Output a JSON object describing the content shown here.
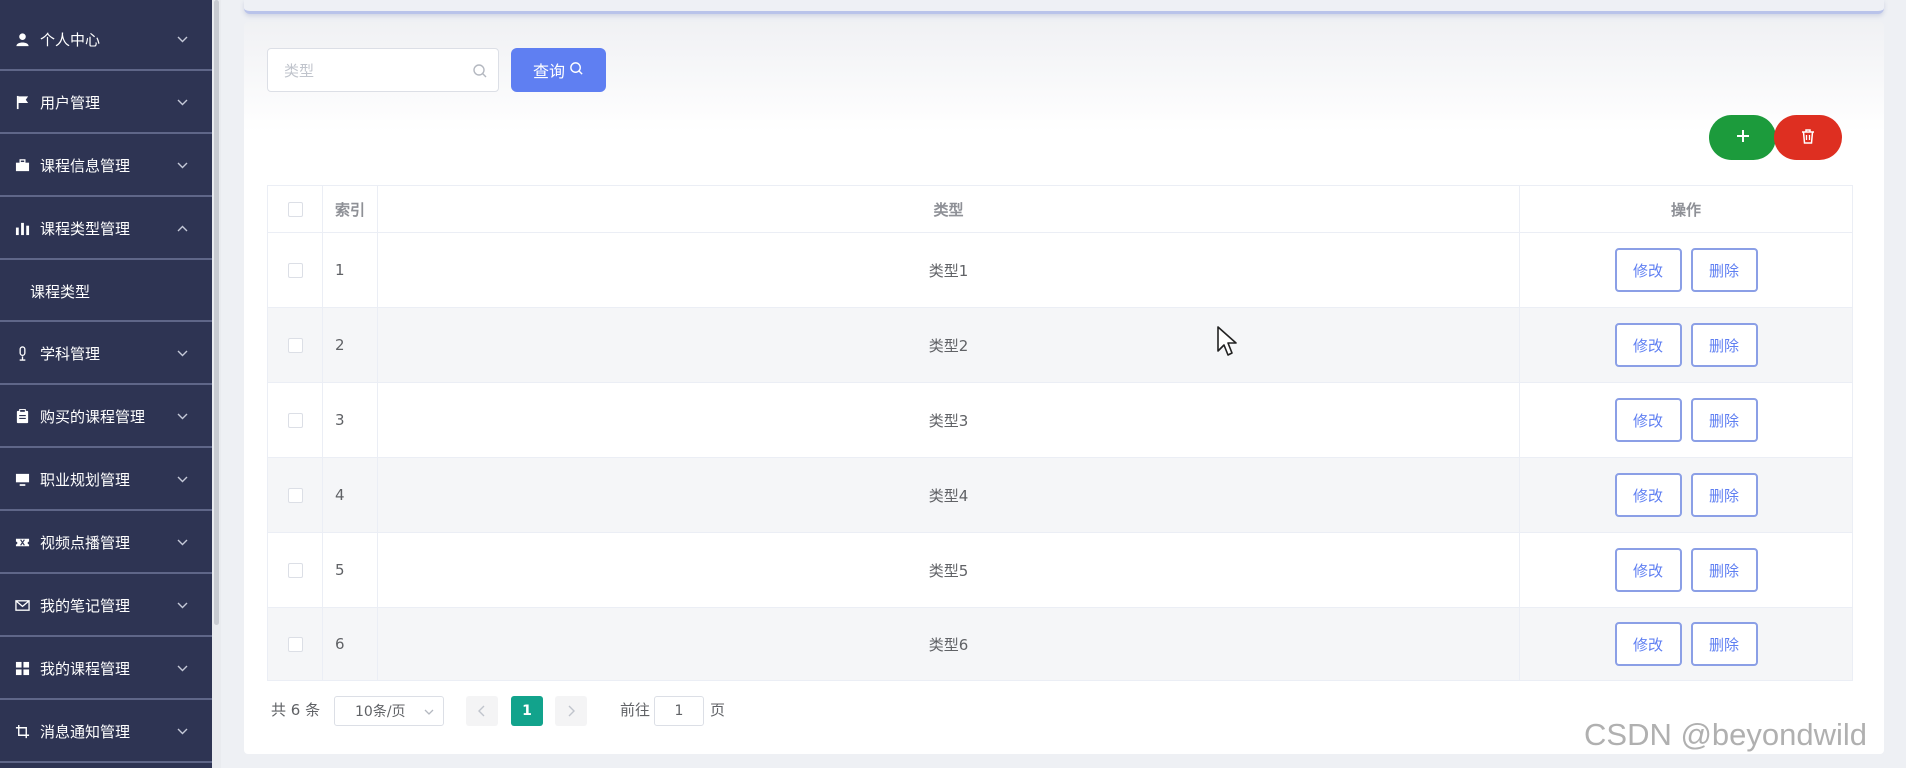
{
  "sidebar": {
    "items": [
      {
        "label": "个人中心",
        "icon": "user-icon"
      },
      {
        "label": "用户管理",
        "icon": "flag-icon"
      },
      {
        "label": "课程信息管理",
        "icon": "briefcase-icon"
      },
      {
        "label": "课程类型管理",
        "icon": "bar-chart-icon",
        "expanded": true
      },
      {
        "label": "学科管理",
        "icon": "microphone-icon"
      },
      {
        "label": "购买的课程管理",
        "icon": "clipboard-icon"
      },
      {
        "label": "职业规划管理",
        "icon": "monitor-icon"
      },
      {
        "label": "视频点播管理",
        "icon": "ticket-icon"
      },
      {
        "label": "我的笔记管理",
        "icon": "mail-icon"
      },
      {
        "label": "我的课程管理",
        "icon": "grid-icon"
      },
      {
        "label": "消息通知管理",
        "icon": "crop-icon"
      }
    ],
    "sub_item": {
      "label": "课程类型"
    }
  },
  "search": {
    "placeholder": "类型",
    "query_label": "查询"
  },
  "table": {
    "headers": {
      "index": "索引",
      "type": "类型",
      "operation": "操作"
    },
    "rows": [
      {
        "index": "1",
        "type": "类型1"
      },
      {
        "index": "2",
        "type": "类型2"
      },
      {
        "index": "3",
        "type": "类型3"
      },
      {
        "index": "4",
        "type": "类型4"
      },
      {
        "index": "5",
        "type": "类型5"
      },
      {
        "index": "6",
        "type": "类型6"
      }
    ],
    "edit_label": "修改",
    "delete_label": "删除"
  },
  "pagination": {
    "total": "共 6 条",
    "page_size": "10条/页",
    "current_page": "1",
    "goto_label": "前往",
    "goto_value": "1",
    "page_suffix": "页"
  },
  "watermark": "CSDN @beyondwild",
  "colors": {
    "sidebar_bg": "#2e3453",
    "primary": "#5f7ff2",
    "add": "#1c9b3c",
    "delete": "#de2f21",
    "page_active": "#12a38c"
  }
}
